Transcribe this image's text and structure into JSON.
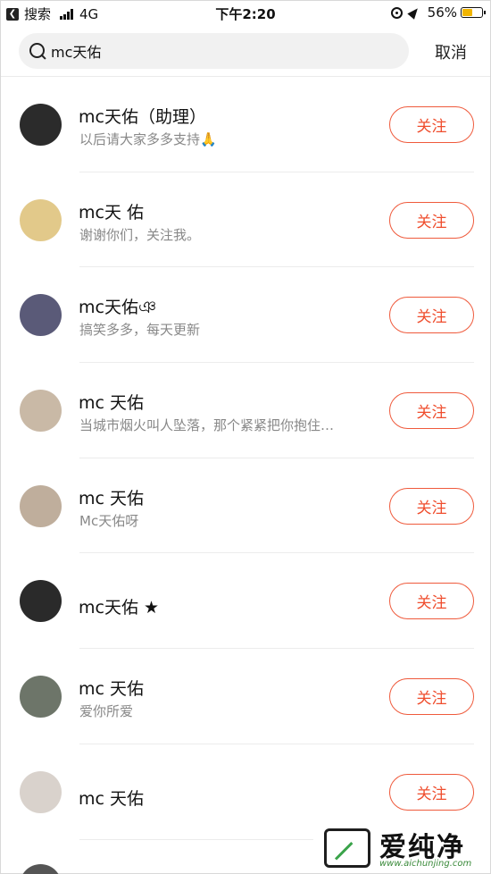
{
  "status_bar": {
    "back_label": "搜索",
    "carrier": "4G",
    "time": "下午2:20",
    "battery": "56%",
    "battery_level": 0.56,
    "icons": [
      "signal-icon",
      "rotation-lock-icon",
      "location-icon",
      "battery-icon"
    ]
  },
  "search": {
    "query": "mc天佑",
    "cancel_label": "取消",
    "icon": "search-icon"
  },
  "follow_label": "关注",
  "results": [
    {
      "name": "mc天佑（助理）",
      "bio": "以后请大家多多支持🙏",
      "avatar_color": "#2b2b2b"
    },
    {
      "name": "mc天 佑",
      "bio": "谢谢你们，关注我。",
      "avatar_color": "#e2c98a"
    },
    {
      "name": "mc天佑ঞ",
      "bio": "搞笑多多，每天更新",
      "avatar_color": "#5a5a78"
    },
    {
      "name": "mc 天佑",
      "bio": "当城市烟火叫人坠落，那个紧紧把你抱住…",
      "avatar_color": "#c9b9a6"
    },
    {
      "name": "mc 天佑",
      "bio": "Mc天佑呀",
      "avatar_color": "#bfae9c"
    },
    {
      "name": "mc天佑 ★",
      "bio": "",
      "avatar_color": "#2a2a2a"
    },
    {
      "name": "mc 天佑",
      "bio": "爱你所爱",
      "avatar_color": "#6d7569"
    },
    {
      "name": "mc 天佑",
      "bio": "",
      "avatar_color": "#d9d2cc"
    }
  ],
  "watermark": {
    "title": "爱纯净",
    "url": "www.aichunjing.com"
  },
  "colors": {
    "accent": "#ef4e2e",
    "battery": "#f1b500",
    "secondary_text": "#888888"
  }
}
